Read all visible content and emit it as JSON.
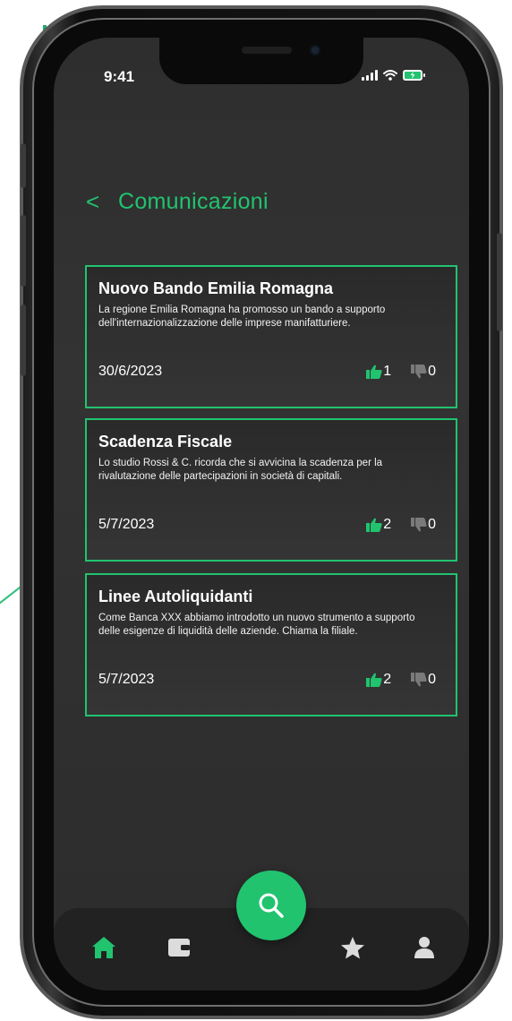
{
  "status_bar": {
    "time": "9:41"
  },
  "header": {
    "back_label": "<",
    "title": "Comunicazioni"
  },
  "cards": [
    {
      "title": "Nuovo Bando Emilia Romagna",
      "description": "La regione Emilia Romagna ha promosso un bando a supporto dell'internazionalizzazione delle imprese manifatturiere.",
      "date": "30/6/2023",
      "likes": "1",
      "dislikes": "0"
    },
    {
      "title": "Scadenza Fiscale",
      "description": "Lo studio Rossi & C. ricorda che si avvicina la scadenza per la rivalutazione delle partecipazioni in società di capitali.",
      "date": "5/7/2023",
      "likes": "2",
      "dislikes": "0"
    },
    {
      "title": "Linee Autoliquidanti",
      "description": "Come Banca XXX abbiamo introdotto un nuovo strumento a supporto delle esigenze di liquidità delle aziende. Chiama la filiale.",
      "date": "5/7/2023",
      "likes": "2",
      "dislikes": "0"
    }
  ],
  "tab_bar": {
    "items": [
      "home-icon",
      "wallet-icon",
      "search-icon",
      "star-icon",
      "user-icon"
    ],
    "active": "home-icon"
  },
  "colors": {
    "accent": "#21c36f",
    "background": "#2f2f2f",
    "tab_bar": "#222222",
    "inactive_icon": "#dcdcdc",
    "dislike_icon": "#7a7a7a"
  }
}
